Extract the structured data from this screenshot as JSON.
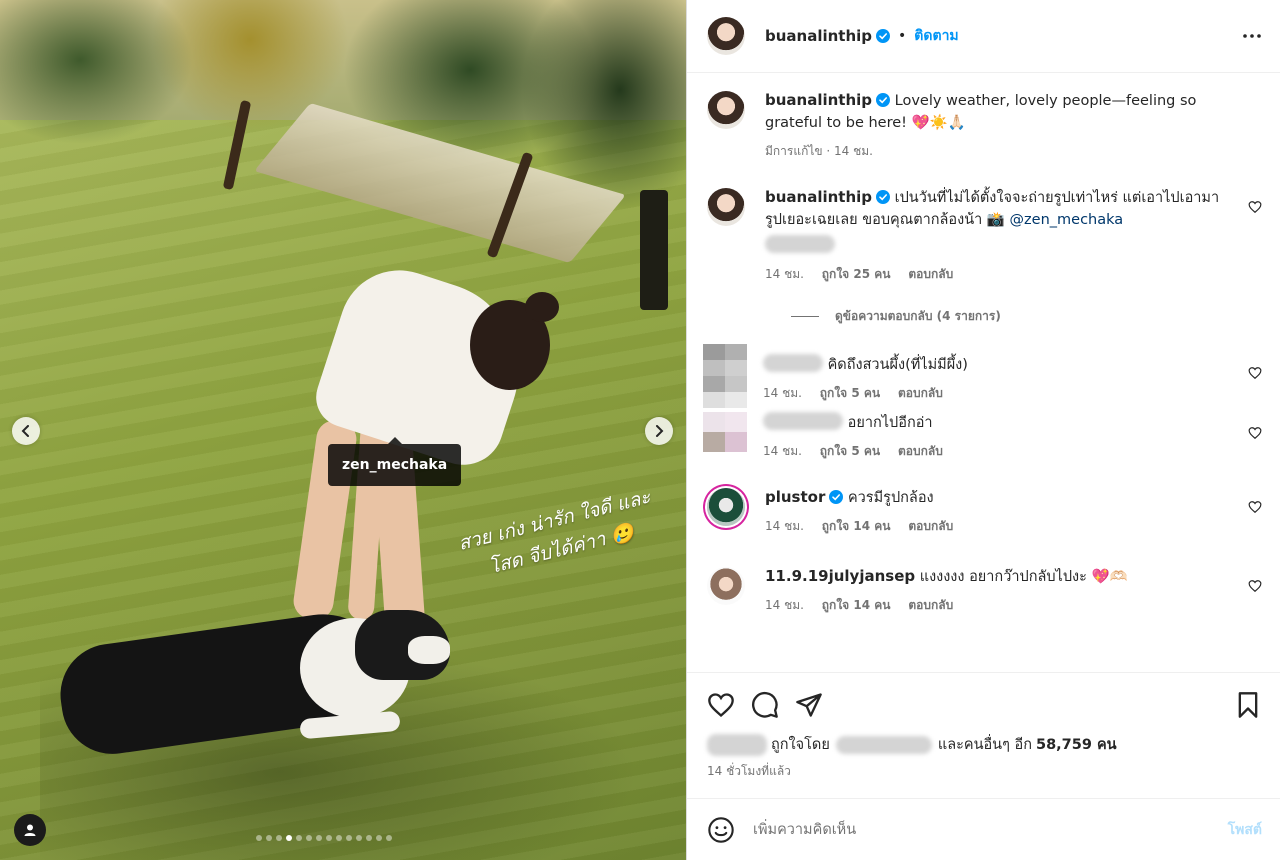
{
  "post": {
    "username": "buanalinthip",
    "follow_label": "ติดตาม",
    "more_icon": "more-horizontal-icon",
    "verified_color": "#0095f6"
  },
  "media": {
    "tag_label": "zen_mechaka",
    "story_text": "สวย เก่ง น่ารัก ใจดี และโสด จีบได้ค่าา 🥲",
    "carousel_count": 14,
    "carousel_active": 4
  },
  "caption": {
    "username": "buanalinthip",
    "text": "Lovely weather, lovely people—feeling so grateful to be here! 💖☀️🙏🏻",
    "meta": "มีการแก้ไข · 14 ชม."
  },
  "comments": [
    {
      "username": "buanalinthip",
      "text_before_mention": "เปนวันที่ไม่ได้ตั้งใจจะถ่ายรูปเท่าไหร่ แต่เอาไปเอามารูปเยอะเฉยเลย ขอบคุณตากล้องน้า 📸 ",
      "mention": "@zen_mechaka",
      "time": "14 ชม.",
      "likes": "ถูกใจ 25 คน",
      "reply": "ตอบกลับ",
      "view_replies": "ดูข้อความตอบกลับ (4 รายการ)"
    },
    {
      "text": "คิดถึงสวนผึ้ง(ที่ไม่มีผึ้ง)",
      "time": "14 ชม.",
      "likes": "ถูกใจ 5 คน",
      "reply": "ตอบกลับ"
    },
    {
      "text": "อยากไปอีกอ่า",
      "time": "14 ชม.",
      "likes": "ถูกใจ 5 คน",
      "reply": "ตอบกลับ"
    },
    {
      "username": "plustor",
      "text": "ควรมีรูปกล้อง",
      "time": "14 ชม.",
      "likes": "ถูกใจ 14 คน",
      "reply": "ตอบกลับ"
    },
    {
      "username": "11.9.19julyjansep",
      "text": "แงงงงง อยากว๊าปกลับไปงะ 💖🫶🏻",
      "time": "14 ชม.",
      "likes": "ถูกใจ 14 คน",
      "reply": "ตอบกลับ"
    }
  ],
  "engagement": {
    "liked_by_prefix": "ถูกใจโดย",
    "liked_by_suffix": "และคนอื่นๆ อีก",
    "like_count": "58,759 คน",
    "time_ago": "14 ชั่วโมงที่แล้ว"
  },
  "composer": {
    "placeholder": "เพิ่มความคิดเห็น",
    "post_label": "โพสต์",
    "post_color": "#b2dffc"
  }
}
